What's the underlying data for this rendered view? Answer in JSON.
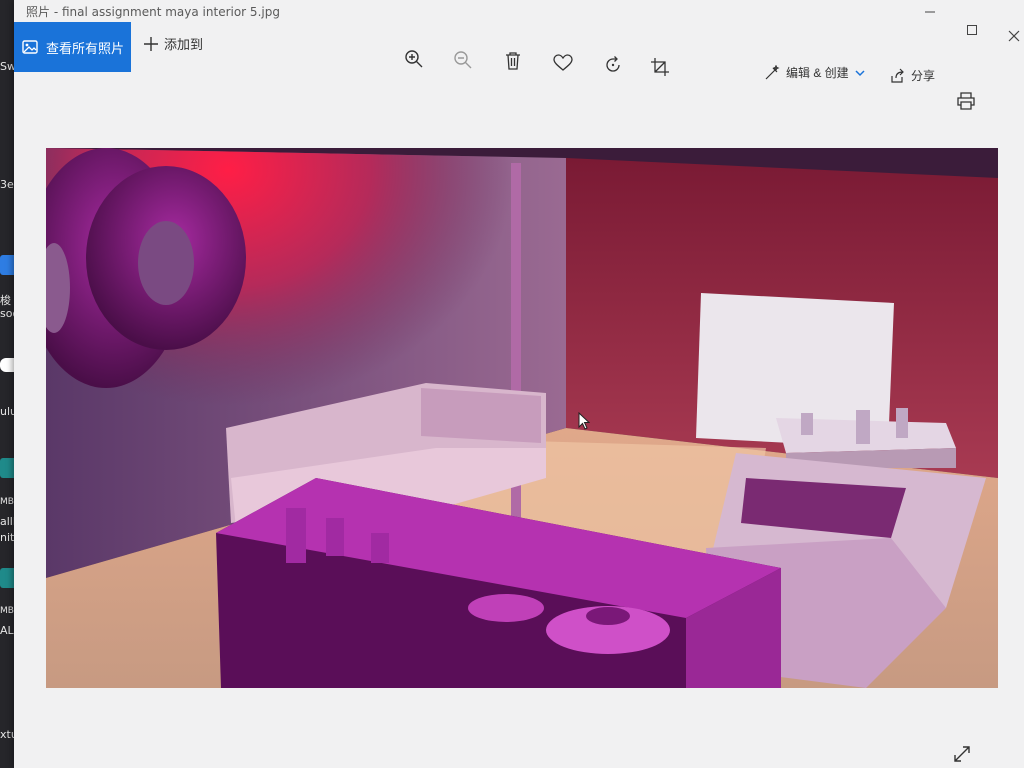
{
  "window": {
    "title": "照片 - final assignment maya interior 5.jpg"
  },
  "toolbar": {
    "see_all_label": "查看所有照片",
    "add_to_label": "添加到",
    "edit_create_label": "编辑 & 创建",
    "share_label": "分享",
    "icons": [
      "zoom-in-icon",
      "zoom-out-icon",
      "delete-icon",
      "favorite-icon",
      "rotate-icon",
      "crop-icon"
    ]
  },
  "desktop": {
    "items": [
      "Sw",
      "3e",
      "梭",
      "soo",
      "ulu",
      "MB",
      "alllll",
      "nity",
      "MB",
      "ALAL",
      "xtures"
    ]
  },
  "colors": {
    "accent": "#1a73d9",
    "window_bg": "#f1f1f2"
  }
}
